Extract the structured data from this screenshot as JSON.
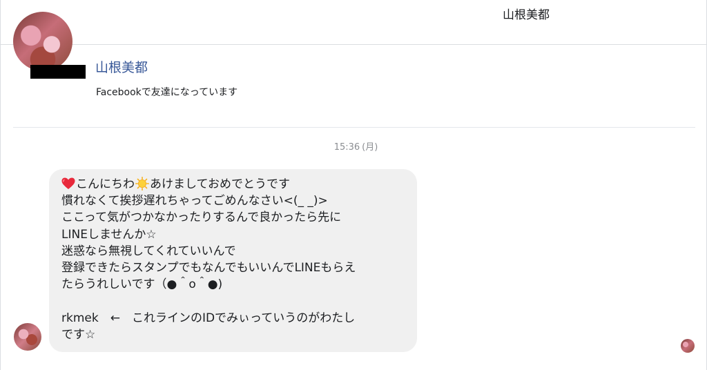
{
  "header": {
    "title": "山根美都"
  },
  "profile": {
    "name": "山根美都",
    "subtitle": "Facebookで友達になっています"
  },
  "conversation": {
    "timestamp_time": "15:36",
    "timestamp_day": "(月)"
  },
  "message": {
    "line1_a": "こんにちわ",
    "line1_b": "あけましておめでとうです",
    "body": "慣れなくて挨拶遅れちゃってごめんなさい<(_ _)>\nここって気がつかなかったりするんで良かったら先に\nLINEしませんか☆\n迷惑なら無視してくれていいんで\n登録できたらスタンプでもなんでもいいんでLINEもらえ\nたらうれしいです（●＾o＾●)\n\nrkmek　←　これラインのIDでみぃっていうのがわたし\nです☆",
    "icons": [
      "heart-icon",
      "sun-icon"
    ]
  },
  "colors": {
    "name_link": "#385898",
    "bubble_bg": "#f0f0f0",
    "timestamp": "#8a8d91",
    "divider": "#dadde1"
  }
}
